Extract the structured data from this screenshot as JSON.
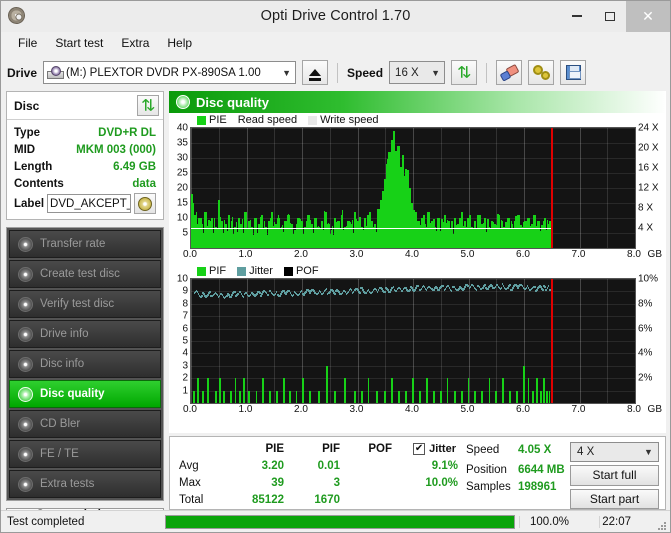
{
  "window": {
    "title": "Opti Drive Control 1.70",
    "app_icon": "disc-icon",
    "minimize": "−",
    "maximize": "□",
    "close": "✕"
  },
  "menu": {
    "items": [
      "File",
      "Start test",
      "Extra",
      "Help"
    ]
  },
  "toolbar": {
    "drive_label": "Drive",
    "drive_value": "(M:)  PLEXTOR DVDR   PX-890SA 1.00",
    "drive_letter": "(M:)",
    "eject_label": "eject-button",
    "speed_label": "Speed",
    "speed_value": "16 X",
    "icons": [
      "refresh-icon",
      "eraser-icon",
      "gears-icon",
      "save-icon"
    ]
  },
  "disc": {
    "title": "Disc",
    "refresh_icon": "refresh-icon",
    "rows": [
      {
        "key": "Type",
        "value": "DVD+R DL"
      },
      {
        "key": "MID",
        "value": "MKM 003 (000)"
      },
      {
        "key": "Length",
        "value": "6.49 GB"
      },
      {
        "key": "Contents",
        "value": "data"
      }
    ],
    "label_key": "Label",
    "label_value": "DVD_AKCEPT_",
    "label_button_icon": "cd-icon"
  },
  "nav": {
    "items": [
      {
        "label": "Transfer rate",
        "active": false
      },
      {
        "label": "Create test disc",
        "active": false
      },
      {
        "label": "Verify test disc",
        "active": false
      },
      {
        "label": "Drive info",
        "active": false
      },
      {
        "label": "Disc info",
        "active": false
      },
      {
        "label": "Disc quality",
        "active": true
      },
      {
        "label": "CD Bler",
        "active": false
      },
      {
        "label": "FE / TE",
        "active": false
      },
      {
        "label": "Extra tests",
        "active": false
      }
    ],
    "status_window_button": "Status window >>"
  },
  "panel": {
    "header_title": "Disc quality",
    "header_icon": "disc-quality-icon"
  },
  "chart_data": [
    {
      "type": "bar",
      "id": "pie-chart",
      "title": "",
      "legend": [
        {
          "label": "PIE",
          "color": "#17d117",
          "swatch": true
        },
        {
          "label": "Read speed",
          "color": "#ffffff",
          "swatch": false
        },
        {
          "label": "Write speed",
          "color": "#e8e8e8",
          "swatch": true
        }
      ],
      "legend_position": "top-left",
      "xlabel": "GB",
      "ylabel": "PIE",
      "xlim": [
        0,
        8
      ],
      "ylim": [
        0,
        40
      ],
      "y2lim": [
        0,
        24
      ],
      "y2label": "X",
      "xticks": [
        "0.0",
        "1.0",
        "2.0",
        "3.0",
        "4.0",
        "5.0",
        "6.0",
        "7.0",
        "8.0"
      ],
      "yticks": [
        40,
        35,
        30,
        25,
        20,
        15,
        10,
        5
      ],
      "y2ticks": [
        "24 X",
        "20 X",
        "16 X",
        "12 X",
        "8 X",
        "4 X"
      ],
      "grid": true,
      "end_marker_gb": 6.49,
      "read_speed_series": {
        "name": "Read speed",
        "color": "#ffffff",
        "x": [
          0.0,
          0.5,
          1.0,
          1.5,
          2.0,
          2.5,
          3.0,
          3.5,
          4.0,
          4.5,
          5.0,
          5.5,
          6.0,
          6.49
        ],
        "values_x": [
          4.05,
          4.05,
          4.05,
          4.05,
          4.05,
          4.05,
          4.05,
          4.05,
          4.05,
          4.05,
          4.05,
          4.05,
          4.05,
          4.05
        ]
      },
      "series": [
        {
          "name": "PIE",
          "color": "#17d117",
          "note": "error counts sampled across disc; baseline ~3, spike to 39 near 3.6 GB",
          "x": [
            0.02,
            0.08,
            0.14,
            0.2,
            0.26,
            0.32,
            0.38,
            0.44,
            0.5,
            0.56,
            0.62,
            0.68,
            0.74,
            0.8,
            0.86,
            0.92,
            0.98,
            1.04,
            1.1,
            1.16,
            1.22,
            1.28,
            1.34,
            1.4,
            1.46,
            1.52,
            1.58,
            1.64,
            1.7,
            1.76,
            1.82,
            1.88,
            1.94,
            2.0,
            2.06,
            2.12,
            2.18,
            2.24,
            2.3,
            2.36,
            2.42,
            2.48,
            2.54,
            2.6,
            2.66,
            2.72,
            2.78,
            2.84,
            2.9,
            2.96,
            3.02,
            3.08,
            3.14,
            3.2,
            3.26,
            3.32,
            3.38,
            3.42,
            3.46,
            3.5,
            3.54,
            3.58,
            3.62,
            3.66,
            3.7,
            3.74,
            3.78,
            3.82,
            3.86,
            3.9,
            3.94,
            3.98,
            4.04,
            4.1,
            4.16,
            4.22,
            4.28,
            4.34,
            4.4,
            4.46,
            4.52,
            4.58,
            4.64,
            4.7,
            4.76,
            4.82,
            4.88,
            4.94,
            5.0,
            5.06,
            5.12,
            5.18,
            5.24,
            5.3,
            5.36,
            5.42,
            5.48,
            5.54,
            5.6,
            5.66,
            5.72,
            5.78,
            5.84,
            5.9,
            5.96,
            6.02,
            6.08,
            6.14,
            6.2,
            6.26,
            6.32,
            6.38,
            6.44,
            6.48
          ],
          "values": [
            18,
            11,
            10,
            8,
            12,
            9,
            10,
            7,
            16,
            9,
            8,
            11,
            9,
            7,
            10,
            8,
            12,
            9,
            7,
            10,
            8,
            11,
            7,
            9,
            12,
            8,
            10,
            7,
            9,
            11,
            8,
            6,
            10,
            9,
            7,
            11,
            8,
            10,
            7,
            9,
            12,
            8,
            6,
            10,
            9,
            11,
            7,
            9,
            8,
            12,
            9,
            7,
            10,
            11,
            9,
            8,
            13,
            16,
            19,
            23,
            28,
            32,
            36,
            39,
            30,
            34,
            27,
            31,
            24,
            26,
            20,
            15,
            11,
            9,
            10,
            8,
            12,
            9,
            7,
            10,
            8,
            11,
            9,
            7,
            10,
            8,
            12,
            9,
            10,
            7,
            9,
            11,
            8,
            10,
            7,
            9,
            8,
            11,
            9,
            7,
            10,
            8,
            9,
            11,
            7,
            9,
            10,
            8,
            11,
            9,
            7,
            10,
            8,
            9
          ]
        }
      ],
      "avg_line_value": 3.2
    },
    {
      "type": "bar",
      "id": "pif-jitter-chart",
      "title": "",
      "legend": [
        {
          "label": "PIF",
          "color": "#17d117",
          "swatch": true
        },
        {
          "label": "Jitter",
          "color": "#5f9ea0",
          "swatch": true
        },
        {
          "label": "POF",
          "color": "#000000",
          "swatch": true
        }
      ],
      "legend_position": "top-left",
      "xlabel": "GB",
      "ylabel": "PIF",
      "xlim": [
        0,
        8
      ],
      "ylim": [
        0,
        10
      ],
      "y2lim": [
        0,
        10
      ],
      "y2label": "%",
      "xticks": [
        "0.0",
        "1.0",
        "2.0",
        "3.0",
        "4.0",
        "5.0",
        "6.0",
        "7.0",
        "8.0"
      ],
      "yticks": [
        10,
        9,
        8,
        7,
        6,
        5,
        4,
        3,
        2,
        1
      ],
      "y2ticks": [
        "10%",
        "8%",
        "6%",
        "4%",
        "2%"
      ],
      "grid": true,
      "end_marker_gb": 6.49,
      "series": [
        {
          "name": "PIF",
          "color": "#17d117",
          "note": "sparse single-sample spikes of 1-3",
          "x": [
            0.05,
            0.12,
            0.22,
            0.3,
            0.45,
            0.52,
            0.6,
            0.72,
            0.8,
            0.88,
            0.95,
            1.05,
            1.18,
            1.3,
            1.42,
            1.55,
            1.68,
            1.78,
            1.9,
            2.02,
            2.15,
            2.3,
            2.45,
            2.6,
            2.78,
            2.95,
            3.08,
            3.2,
            3.35,
            3.5,
            3.62,
            3.75,
            3.88,
            4.0,
            4.12,
            4.25,
            4.38,
            4.5,
            4.62,
            4.75,
            4.88,
            5.0,
            5.12,
            5.25,
            5.38,
            5.5,
            5.62,
            5.75,
            5.88,
            6.0,
            6.08,
            6.16,
            6.24,
            6.3,
            6.36,
            6.42,
            6.46
          ],
          "values": [
            1,
            2,
            1,
            2,
            1,
            2,
            1,
            1,
            2,
            1,
            2,
            1,
            1,
            2,
            1,
            1,
            2,
            1,
            1,
            2,
            1,
            1,
            3,
            1,
            2,
            1,
            1,
            2,
            1,
            1,
            2,
            1,
            1,
            2,
            1,
            2,
            1,
            1,
            2,
            1,
            1,
            2,
            1,
            1,
            2,
            1,
            2,
            1,
            1,
            3,
            2,
            1,
            2,
            1,
            2,
            1,
            1
          ]
        },
        {
          "name": "Jitter",
          "color": "#5f9ea0",
          "unit": "%",
          "x": [
            0.05,
            0.2,
            0.35,
            0.5,
            0.65,
            0.8,
            0.95,
            1.1,
            1.25,
            1.4,
            1.55,
            1.7,
            1.85,
            2.0,
            2.15,
            2.3,
            2.45,
            2.6,
            2.75,
            2.9,
            3.05,
            3.2,
            3.35,
            3.5,
            3.65,
            3.8,
            3.95,
            4.1,
            4.25,
            4.4,
            4.55,
            4.7,
            4.85,
            5.0,
            5.15,
            5.3,
            5.45,
            5.6,
            5.75,
            5.9,
            6.05,
            6.2,
            6.35,
            6.48
          ],
          "values": [
            8.9,
            8.7,
            8.8,
            8.6,
            8.7,
            8.8,
            8.7,
            8.8,
            8.8,
            8.9,
            8.8,
            8.9,
            8.8,
            8.9,
            9.0,
            8.9,
            9.0,
            8.9,
            9.0,
            9.0,
            9.1,
            9.0,
            9.1,
            9.1,
            9.2,
            9.1,
            9.2,
            9.3,
            9.2,
            9.3,
            9.3,
            9.2,
            9.3,
            9.4,
            9.3,
            9.4,
            9.3,
            9.4,
            9.3,
            9.4,
            9.3,
            9.2,
            9.3,
            9.2
          ]
        },
        {
          "name": "POF",
          "color": "#000000",
          "x": [],
          "values": []
        }
      ]
    }
  ],
  "stats": {
    "columns": [
      "PIE",
      "PIF",
      "POF",
      "Jitter"
    ],
    "jitter_checked": true,
    "jitter_check_glyph": "✔",
    "rows": [
      {
        "label": "Avg",
        "pie": "3.20",
        "pif": "0.01",
        "pof": "",
        "jitter": "9.1%"
      },
      {
        "label": "Max",
        "pie": "39",
        "pif": "3",
        "pof": "",
        "jitter": "10.0%"
      },
      {
        "label": "Total",
        "pie": "85122",
        "pif": "1670",
        "pof": "",
        "jitter": ""
      }
    ],
    "readouts": [
      {
        "key": "Speed",
        "value": "4.05 X"
      },
      {
        "key": "Position",
        "value": "6644 MB"
      },
      {
        "key": "Samples",
        "value": "198961"
      }
    ],
    "speed_select": "4 X",
    "start_full_button": "Start full",
    "start_part_button": "Start part"
  },
  "statusbar": {
    "message": "Test completed",
    "progress_percent": "100.0%",
    "progress_value": 100,
    "time": "22:07"
  },
  "colors": {
    "accent_green": "#17d117",
    "header_green": "#0a9a0a",
    "value_green": "#1f9b1f",
    "jitter_teal": "#5f9ea0",
    "end_marker_red": "#e00000",
    "plot_bg": "#141414"
  }
}
